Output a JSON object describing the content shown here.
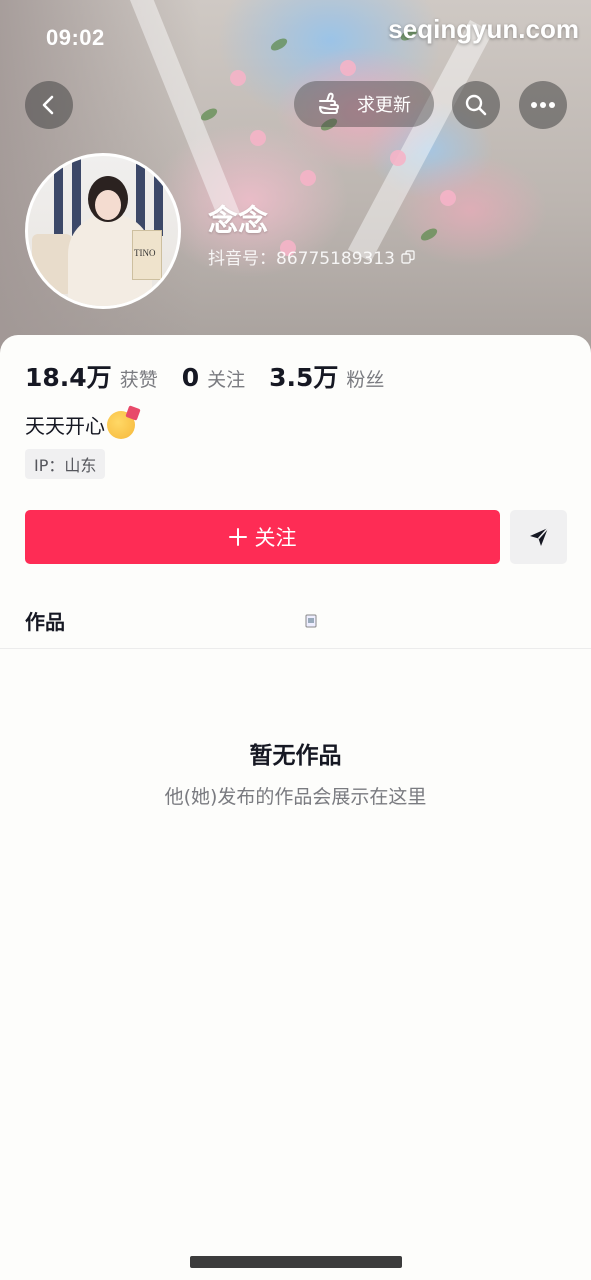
{
  "status_bar": {
    "time": "09:02"
  },
  "watermark": "seqingyun.com",
  "header": {
    "request_update_label": "求更新",
    "nickname": "念念",
    "douyin_id": "抖音号：86775189313"
  },
  "avatar": {
    "bag_text": "TINO"
  },
  "stats": [
    {
      "value": "18.4万",
      "label": "获赞"
    },
    {
      "value": "0",
      "label": "关注"
    },
    {
      "value": "3.5万",
      "label": "粉丝"
    }
  ],
  "bio": "天天开心",
  "ip_location": "IP：山东",
  "actions": {
    "follow_label": "关注"
  },
  "tabs": {
    "works": "作品"
  },
  "empty_state": {
    "title": "暂无作品",
    "subtitle": "他(她)发布的作品会展示在这里"
  },
  "colors": {
    "accent": "#fe2c55",
    "text": "#161823",
    "muted": "#7a7b80"
  }
}
